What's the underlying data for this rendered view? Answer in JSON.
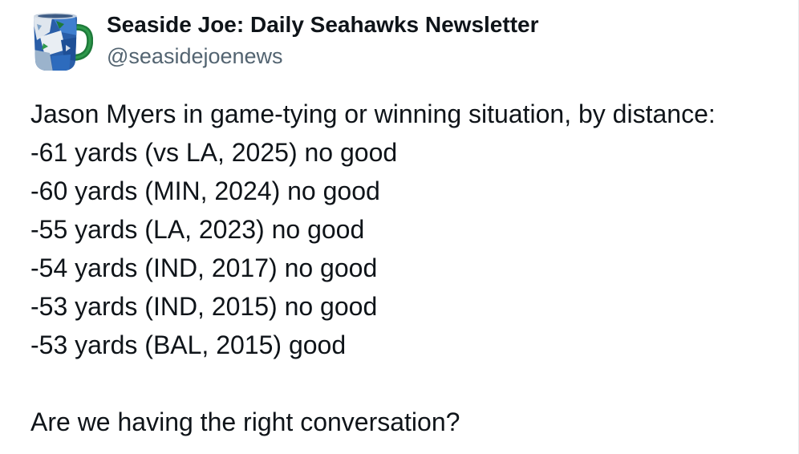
{
  "tweet": {
    "author": {
      "display_name": "Seaside Joe: Daily Seahawks Newsletter",
      "handle": "@seasidejoenews",
      "avatar_icon": "seahawks-mug-avatar"
    },
    "intro": "Jason Myers in game-tying or winning situation, by distance:",
    "kicks": [
      "-61 yards (vs LA, 2025) no good",
      "-60 yards (MIN, 2024) no good",
      "-55 yards (LA, 2023) no good",
      "-54 yards (IND, 2017) no good",
      "-53 yards (IND, 2015) no good",
      "-53 yards (BAL, 2015) good"
    ],
    "closing": "Are we having the right conversation?"
  },
  "colors": {
    "text": "#0f1419",
    "muted": "#536471",
    "mug_green": "#1e7a3a",
    "mug_blue": "#2a5ea8"
  }
}
